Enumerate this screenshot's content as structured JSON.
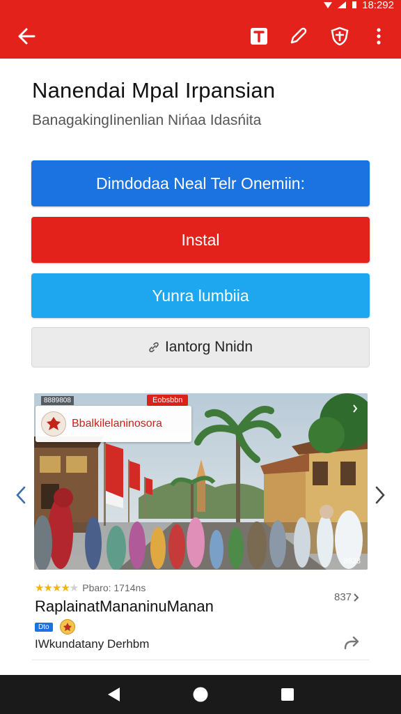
{
  "status_bar": {
    "time": "18:292"
  },
  "app_bar": {
    "back_icon": "arrow-back-icon",
    "actions": [
      "text-format-icon",
      "pencil-icon",
      "shield-icon",
      "more-vert-icon"
    ]
  },
  "header": {
    "title": "Nanendai Mpal Irpansian",
    "subtitle": "BanagakingIinenlian Nińaa Idasńita"
  },
  "buttons": {
    "primary_label": "Dimdodaa Neal Telr Onemiin:",
    "install_label": "Instal",
    "secondary_label": "Yunra lumbiia",
    "tertiary_label": "Iantorg Nnidn",
    "tertiary_icon": "link-icon"
  },
  "card": {
    "badge_left": "8889808",
    "badge_right": "Eobsbbn",
    "overlay_title": "Bbalkilelaninosora",
    "image_counter": "8928",
    "rating": 4,
    "rating_max": 5,
    "rating_text": "Pbaro: 1714ns",
    "title": "RaplainatMananinuManan",
    "count_link": "837",
    "chip_label": "Dto",
    "author": "IWkundatany Derhbm"
  },
  "colors": {
    "app_bar": "#e3221c",
    "primary_button": "#1a73e0",
    "install_button": "#e3221c",
    "secondary_button": "#1ea7ee",
    "tertiary_button": "#ebebeb"
  },
  "nav_bar": {
    "items": [
      "back-triangle-icon",
      "home-circle-icon",
      "recents-square-icon"
    ]
  }
}
